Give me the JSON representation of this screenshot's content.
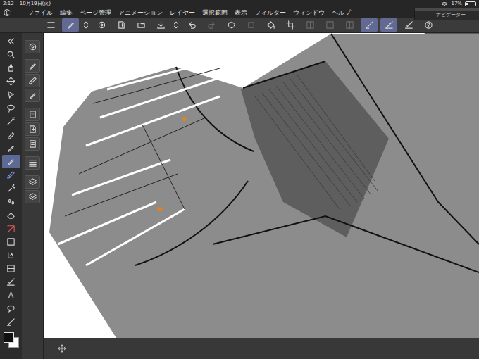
{
  "status_bar": {
    "time": "2:12",
    "date": "10月19日(火)",
    "battery": "17%",
    "battery_level": 0.17
  },
  "menu": [
    "ファイル",
    "編集",
    "ページ管理",
    "アニメーション",
    "レイヤー",
    "選択範囲",
    "表示",
    "フィルター",
    "ウィンドウ",
    "ヘルプ"
  ],
  "navigator": {
    "title": "ナビゲーター"
  },
  "toolbar": [
    {
      "kind": "button",
      "selected": false,
      "disabled": false
    },
    {
      "kind": "button",
      "selected": true,
      "disabled": false
    },
    {
      "kind": "spinner",
      "selected": false,
      "disabled": false
    },
    {
      "kind": "button",
      "selected": false,
      "disabled": false
    },
    {
      "kind": "button",
      "selected": false,
      "disabled": false
    },
    {
      "kind": "button",
      "selected": false,
      "disabled": false
    },
    {
      "kind": "button",
      "selected": false,
      "disabled": false
    },
    {
      "kind": "spinner",
      "selected": false,
      "disabled": false
    },
    {
      "kind": "button",
      "selected": false,
      "disabled": false
    },
    {
      "kind": "button",
      "selected": false,
      "disabled": true
    },
    {
      "kind": "button",
      "selected": false,
      "disabled": false
    },
    {
      "kind": "button",
      "selected": false,
      "disabled": true
    },
    {
      "kind": "button",
      "selected": false,
      "disabled": false
    },
    {
      "kind": "button",
      "selected": false,
      "disabled": false
    },
    {
      "kind": "button",
      "selected": false,
      "disabled": true
    },
    {
      "kind": "button",
      "selected": false,
      "disabled": true
    },
    {
      "kind": "button",
      "selected": false,
      "disabled": true
    },
    {
      "kind": "button",
      "selected": true,
      "disabled": false
    },
    {
      "kind": "button",
      "selected": true,
      "disabled": false
    },
    {
      "kind": "button",
      "selected": false,
      "disabled": false
    },
    {
      "kind": "button",
      "selected": false,
      "disabled": false
    }
  ],
  "tools": [
    {
      "kind": "icon",
      "selected": false
    },
    {
      "kind": "icon",
      "selected": false
    },
    {
      "kind": "icon",
      "selected": false
    },
    {
      "kind": "icon",
      "selected": false
    },
    {
      "kind": "icon",
      "selected": false
    },
    {
      "kind": "icon",
      "selected": false
    },
    {
      "kind": "icon",
      "selected": false
    },
    {
      "kind": "icon",
      "selected": false
    },
    {
      "kind": "icon",
      "selected": false
    },
    {
      "kind": "icon",
      "selected": true
    },
    {
      "kind": "icon",
      "selected": false
    },
    {
      "kind": "icon",
      "selected": false
    },
    {
      "kind": "icon",
      "selected": false
    },
    {
      "kind": "icon",
      "selected": false
    },
    {
      "kind": "icon",
      "selected": false
    },
    {
      "kind": "icon",
      "selected": false
    },
    {
      "kind": "icon",
      "selected": false
    },
    {
      "kind": "icon",
      "selected": false
    },
    {
      "kind": "icon",
      "selected": false
    },
    {
      "kind": "text",
      "label": "A",
      "selected": false
    },
    {
      "kind": "icon",
      "selected": false
    },
    {
      "kind": "icon",
      "selected": false
    }
  ],
  "sub_tools": [
    {
      "selected": false
    },
    {
      "selected": false
    },
    {
      "selected": false
    },
    {
      "selected": false
    },
    {
      "selected": false
    },
    {
      "selected": false
    },
    {
      "selected": false
    },
    {
      "selected": false
    },
    {
      "selected": false
    },
    {
      "selected": false
    }
  ],
  "colors": [
    {
      "color": "#111111",
      "selected": true
    },
    {
      "color": "#ffffff",
      "selected": false
    }
  ]
}
